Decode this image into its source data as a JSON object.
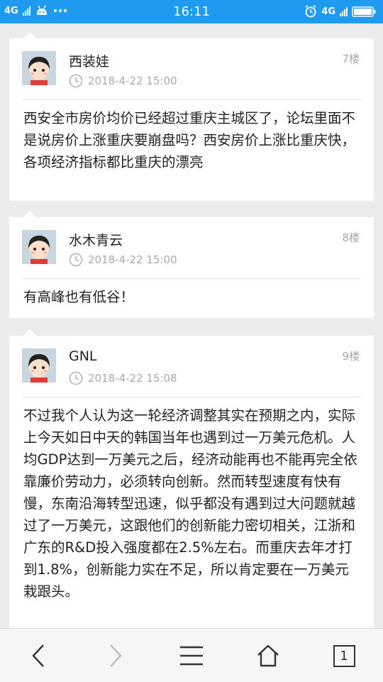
{
  "status_bar": {
    "network_left": "4G",
    "time": "16:11",
    "network_right": "4G"
  },
  "posts": [
    {
      "author": "西装娃",
      "floor": "7楼",
      "time": "2018-4-22 15:00",
      "content": "西安全市房价均价已经超过重庆主城区了，论坛里面不是说房价上涨重庆要崩盘吗？西安房价上涨比重庆快，各项经济指标都比重庆的漂亮"
    },
    {
      "author": "水木青云",
      "floor": "8楼",
      "time": "2018-4-22 15:00",
      "content": "有高峰也有低谷！"
    },
    {
      "author": "GNL",
      "floor": "9楼",
      "time": "2018-4-22 15:08",
      "content": "不过我个人认为这一轮经济调整其实在预期之内，实际上今天如日中天的韩国当年也遇到过一万美元危机。人均GDP达到一万美元之后，经济动能再也不能再完全依靠廉价劳动力，必须转向创新。然而转型速度有快有慢，东南沿海转型迅速，似乎都没有遇到过大问题就越过了一万美元，这跟他们的创新能力密切相关，江浙和广东的R&D投入强度都在2.5%左右。而重庆去年才打到1.8%，创新能力实在不足，所以肯定要在一万美元栽跟头。"
    }
  ],
  "bottom_nav": {
    "tabs_count": "1"
  }
}
